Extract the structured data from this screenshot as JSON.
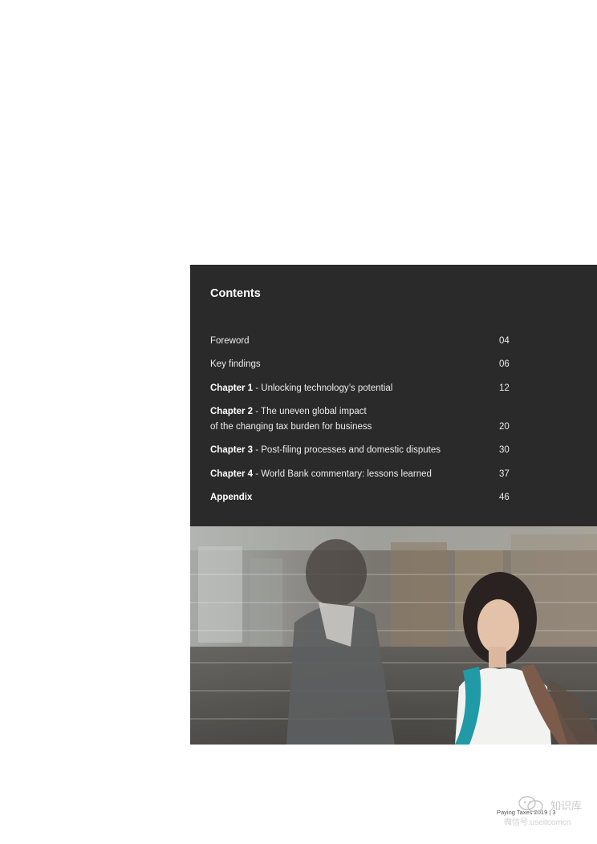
{
  "contents": {
    "title": "Contents",
    "entries": [
      {
        "bold": "",
        "text": "Foreword",
        "page": "04"
      },
      {
        "bold": "",
        "text": "Key findings",
        "page": "06"
      },
      {
        "bold": "Chapter 1",
        "text": " - Unlocking technology’s potential",
        "page": "12"
      },
      {
        "bold": "Chapter 2",
        "text": " - The uneven global impact",
        "text2": "of the changing tax burden for business",
        "page": "20"
      },
      {
        "bold": "Chapter 3",
        "text": " - Post-filing processes and domestic disputes",
        "page": "30"
      },
      {
        "bold": "Chapter 4",
        "text": " - World Bank commentary: lessons learned",
        "page": "37"
      },
      {
        "bold": "Appendix",
        "text": "",
        "page": "46"
      }
    ]
  },
  "footer": {
    "text": "Paying Taxes 2019",
    "separator": "|",
    "page_number": "3"
  },
  "watermark": {
    "line1": "知识库",
    "line2": "微信号:useitcomcn",
    "icon": "wechat-icon"
  }
}
